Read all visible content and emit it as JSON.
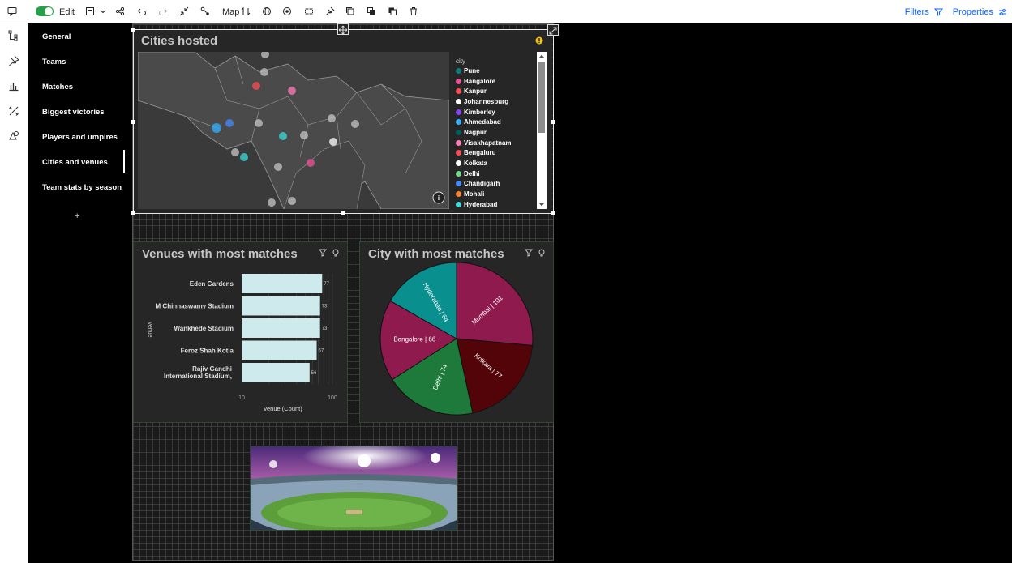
{
  "toolbar": {
    "edit_label": "Edit",
    "map_label": "Map",
    "filters_label": "Filters",
    "properties_label": "Properties"
  },
  "sidebar": {
    "items": [
      {
        "label": "General"
      },
      {
        "label": "Teams"
      },
      {
        "label": "Matches"
      },
      {
        "label": "Biggest victories"
      },
      {
        "label": "Players and umpires"
      },
      {
        "label": "Cities and venues"
      },
      {
        "label": "Team stats by season"
      }
    ],
    "add_label": "+"
  },
  "map_panel": {
    "title": "Cities hosted",
    "legend_title": "city",
    "legend": [
      {
        "name": "Pune",
        "color": "#0e7c7b"
      },
      {
        "name": "Bangalore",
        "color": "#ee5396"
      },
      {
        "name": "Kanpur",
        "color": "#fa4d56"
      },
      {
        "name": "Johannesburg",
        "color": "#ffffff"
      },
      {
        "name": "Kimberley",
        "color": "#8a3ffc"
      },
      {
        "name": "Ahmedabad",
        "color": "#33b1ff"
      },
      {
        "name": "Nagpur",
        "color": "#005d5d"
      },
      {
        "name": "Visakhapatnam",
        "color": "#ff7eb6"
      },
      {
        "name": "Bengaluru",
        "color": "#fa4d56"
      },
      {
        "name": "Kolkata",
        "color": "#ffffff"
      },
      {
        "name": "Delhi",
        "color": "#6fdc8c"
      },
      {
        "name": "Chandigarh",
        "color": "#4589ff"
      },
      {
        "name": "Mohali",
        "color": "#ff832b"
      },
      {
        "name": "Hyderabad",
        "color": "#3ddbd9"
      }
    ]
  },
  "venues_panel": {
    "title": "Venues with most matches",
    "y_axis_label": "venue",
    "chart_data": {
      "type": "bar",
      "orientation": "horizontal",
      "categories": [
        "Eden Gardens",
        "M Chinnaswamy Stadium",
        "Wankhede Stadium",
        "Feroz Shah Kotla",
        "Rajiv Gandhi International Stadium,"
      ],
      "values": [
        77,
        73,
        73,
        67,
        56
      ],
      "xlabel": "venue (Count)",
      "ylabel": "venue",
      "x_scale": "log",
      "xlim": [
        10,
        100
      ],
      "x_ticks": [
        "10",
        "100"
      ],
      "bar_color": "#cfeaed"
    }
  },
  "city_panel": {
    "title": "City with most matches",
    "chart_data": {
      "type": "pie",
      "categories": [
        "Mumbai",
        "Kolkata",
        "Delhi",
        "Bangalore",
        "Hyderabad"
      ],
      "values": [
        101,
        77,
        74,
        66,
        64
      ],
      "labels": [
        "Mumbai | 101",
        "Kolkata | 77",
        "Delhi | 74",
        "Bangalore | 66",
        "Hyderabad | 64"
      ],
      "colors": [
        "#8e1a4e",
        "#520408",
        "#1d7a3a",
        "#8e1a4e",
        "#0a8f8f"
      ]
    }
  }
}
